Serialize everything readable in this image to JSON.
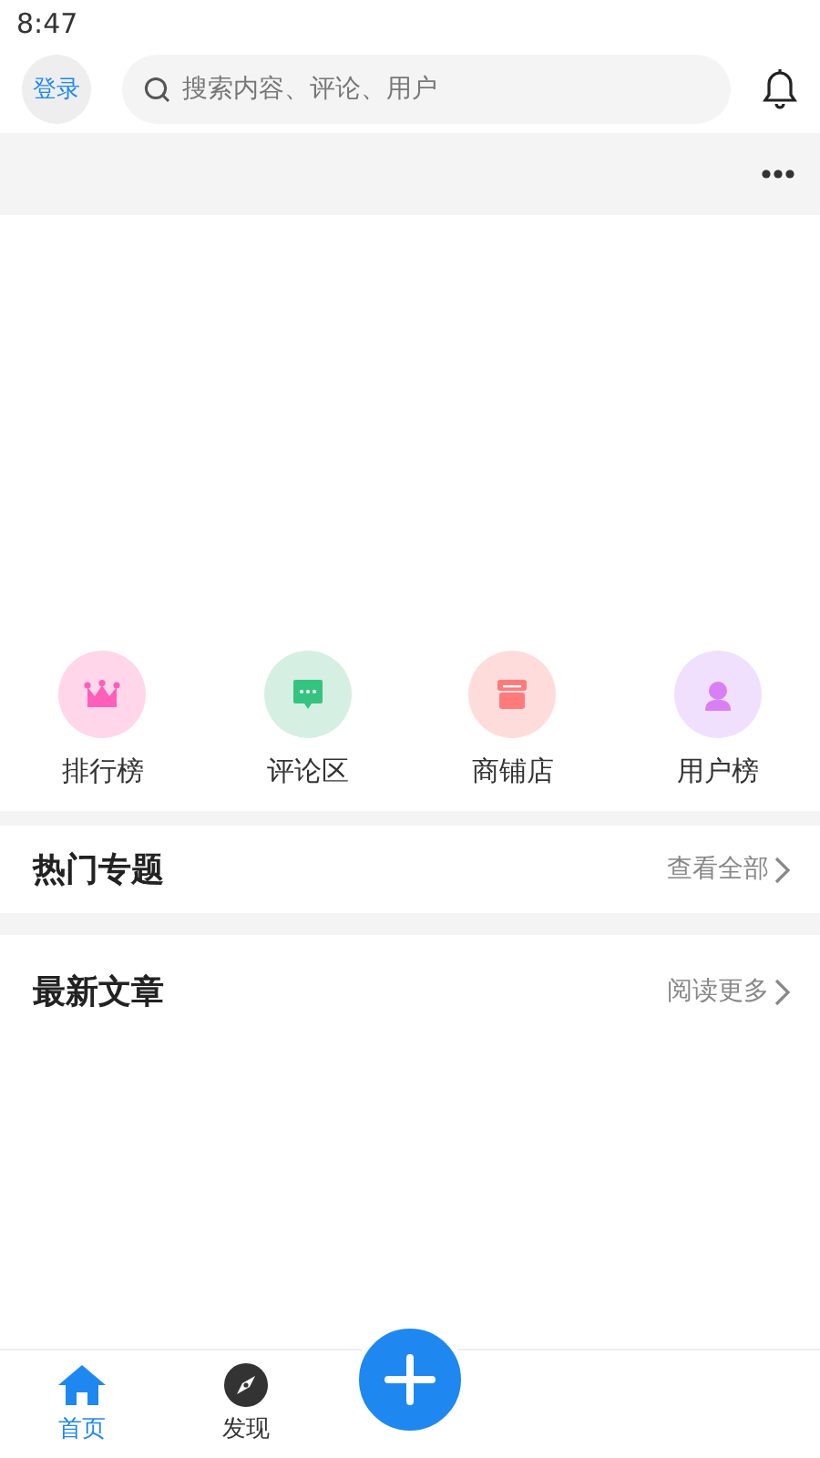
{
  "status_bar": {
    "time": "8:47"
  },
  "header": {
    "login": "登录",
    "search": {
      "placeholder": "搜索内容、评论、用户"
    }
  },
  "shortcuts": [
    {
      "label": "排行榜",
      "kind": "crown",
      "color": "#ffd6ea"
    },
    {
      "label": "评论区",
      "kind": "comment",
      "color": "#d6efe3"
    },
    {
      "label": "商铺店",
      "kind": "shop",
      "color": "#ffdcdc"
    },
    {
      "label": "用户榜",
      "kind": "user",
      "color": "#f1e0fd"
    }
  ],
  "sections": [
    {
      "title": "热门专题",
      "link": "查看全部"
    },
    {
      "title": "最新文章",
      "link": "阅读更多"
    }
  ],
  "bottom_nav": [
    {
      "label": "首页",
      "kind": "home",
      "selected": true
    },
    {
      "label": "发现",
      "kind": "compass",
      "selected": false
    },
    {
      "kind": "add"
    }
  ]
}
